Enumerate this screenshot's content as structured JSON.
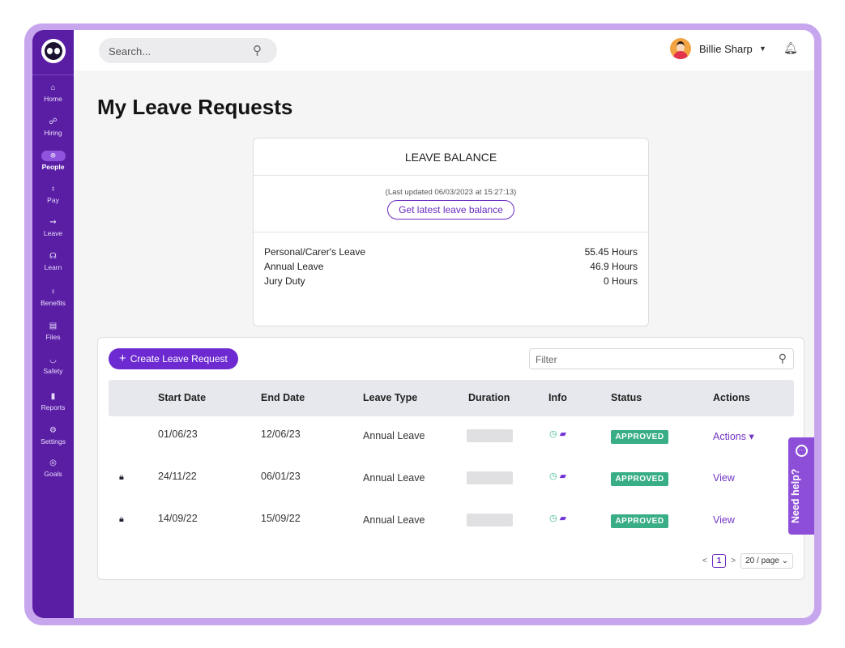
{
  "sidebar": {
    "items": [
      {
        "icon": "home-icon",
        "glyph": "⌂",
        "label": "Home"
      },
      {
        "icon": "hiring-icon",
        "glyph": "☍",
        "label": "Hiring"
      },
      {
        "icon": "people-icon",
        "glyph": "ꔮ",
        "label": "People"
      },
      {
        "icon": "pay-icon",
        "glyph": "♁",
        "label": "Pay"
      },
      {
        "icon": "leave-icon",
        "glyph": "⇝",
        "label": "Leave"
      },
      {
        "icon": "learn-icon",
        "glyph": "☊",
        "label": "Learn"
      },
      {
        "icon": "benefits-icon",
        "glyph": "♀",
        "label": "Benefits"
      },
      {
        "icon": "files-icon",
        "glyph": "▤",
        "label": "Files"
      },
      {
        "icon": "safety-icon",
        "glyph": "◡",
        "label": "Safety"
      },
      {
        "icon": "reports-icon",
        "glyph": "▮",
        "label": "Reports"
      },
      {
        "icon": "settings-icon",
        "glyph": "⚙",
        "label": "Settings"
      },
      {
        "icon": "goals-icon",
        "glyph": "◎",
        "label": "Goals"
      }
    ]
  },
  "topbar": {
    "search_placeholder": "Search...",
    "user_name": "Billie Sharp"
  },
  "page": {
    "title": "My Leave Requests"
  },
  "balance": {
    "heading": "LEAVE BALANCE",
    "updated": "(Last updated 06/03/2023 at 15:27:13)",
    "button": "Get latest leave balance",
    "rows": [
      {
        "type": "Personal/Carer's Leave",
        "hours": "55.45 Hours"
      },
      {
        "type": "Annual Leave",
        "hours": "46.9 Hours"
      },
      {
        "type": "Jury Duty",
        "hours": "0 Hours"
      }
    ]
  },
  "requests": {
    "create_label": "Create Leave Request",
    "filter_placeholder": "Filter",
    "columns": [
      "Start Date",
      "End Date",
      "Leave Type",
      "Duration",
      "Info",
      "Status",
      "Actions"
    ],
    "rows": [
      {
        "locked": false,
        "start": "01/06/23",
        "end": "12/06/23",
        "type": "Annual Leave",
        "status": "APPROVED",
        "action": "Actions ▾"
      },
      {
        "locked": true,
        "start": "24/11/22",
        "end": "06/01/23",
        "type": "Annual Leave",
        "status": "APPROVED",
        "action": "View"
      },
      {
        "locked": true,
        "start": "14/09/22",
        "end": "15/09/22",
        "type": "Annual Leave",
        "status": "APPROVED",
        "action": "View"
      }
    ],
    "pagination": {
      "prev": "<",
      "current": "1",
      "next": ">",
      "page_size": "20 / page ⌄"
    }
  },
  "help": {
    "label": "Need help?"
  },
  "colors": {
    "sidebar": "#5a1ea5",
    "accent": "#6d2ad1",
    "approved": "#39ae86",
    "frame": "#c7a6ee"
  }
}
